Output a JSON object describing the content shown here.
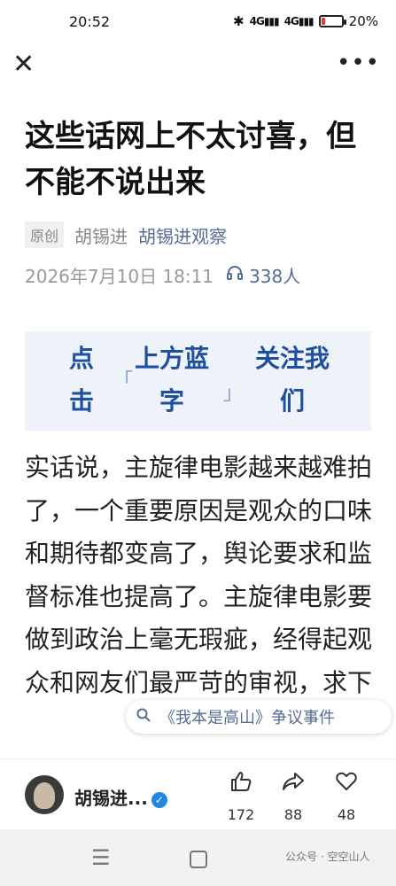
{
  "status_bar": {
    "time": "20:52",
    "bluetooth_icon": "bluetooth-icon",
    "signal1": "4G",
    "signal2": "4G",
    "battery_percent": "20%",
    "battery_level": 0.2,
    "battery_color": "#e53935"
  },
  "top_bar": {
    "close_icon": "close-icon",
    "more_icon": "more-icon"
  },
  "article": {
    "title": "这些话网上不太讨喜，但不能不说出来",
    "badge": "原创",
    "author": "胡锡进",
    "account": "胡锡进观察",
    "datetime": "2026年7月10日 18:11",
    "listeners": "338人",
    "banner": {
      "w1a": "点",
      "w1b": "击",
      "w2a": "上方蓝",
      "w2b": "字",
      "w3a": "关注我",
      "w3b": "们"
    },
    "body": "实话说，主旋律电影越来越难拍了，一个重要原因是观众的口味和期待都变高了，舆论要求和监督标准也提高了。主旋律电影要做到政治上毫无瑕疵，经得起观众和网友们最严苛的审视，求下"
  },
  "topic_pill": {
    "icon": "search-icon",
    "text": "《我本是高山》争议事件"
  },
  "bottom_bar": {
    "account_name": "胡锡进...",
    "verified_icon": "verified-icon",
    "like_count": "172",
    "share_count": "88",
    "wow_count": "48"
  },
  "nav": {
    "watermark": "公众号 · 空空山人"
  },
  "colors": {
    "accent": "#576b95",
    "banner_text": "#1e4fa3",
    "banner_bg": "#eef2f9"
  }
}
